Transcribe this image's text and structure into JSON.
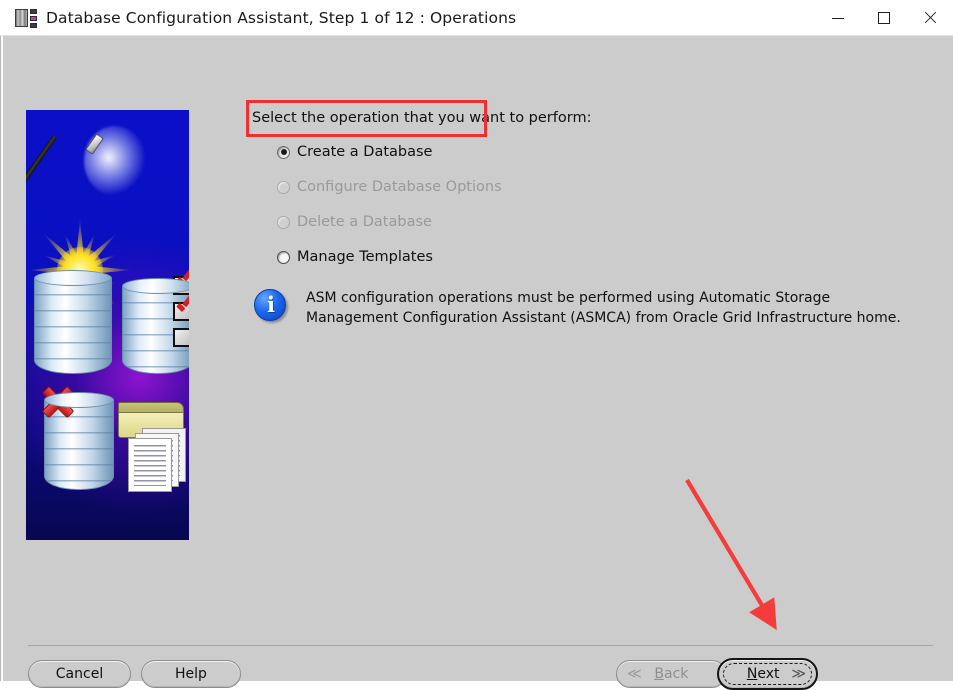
{
  "window": {
    "title": "Database Configuration Assistant, Step 1 of 12 : Operations",
    "app_icon": "database-app-icon",
    "controls": {
      "minimize": "minimize-icon",
      "maximize": "maximize-icon",
      "close": "close-icon"
    }
  },
  "banner": {
    "alt": "oracle-dbca-wizard-graphic"
  },
  "main": {
    "prompt": "Select the operation that you want to perform:",
    "options": [
      {
        "label": "Create a Database",
        "selected": true,
        "enabled": true
      },
      {
        "label": "Configure Database Options",
        "selected": false,
        "enabled": false
      },
      {
        "label": "Delete a Database",
        "selected": false,
        "enabled": false
      },
      {
        "label": "Manage Templates",
        "selected": false,
        "enabled": true
      }
    ],
    "info": {
      "icon": "info-icon",
      "line1": "ASM configuration operations must be performed using Automatic Storage",
      "line2": "Management Configuration Assistant (ASMCA) from Oracle Grid Infrastructure home."
    }
  },
  "annotations": {
    "highlight_color": "#f03030",
    "highlight_target": "Create a Database",
    "arrow_color": "#f43c3c",
    "arrow_target": "Next"
  },
  "footer": {
    "cancel": "Cancel",
    "help": "Help",
    "back": "Back",
    "back_enabled": false,
    "next": "Next",
    "next_focused": true,
    "back_chevron": "≪",
    "next_chevron": "≫"
  }
}
